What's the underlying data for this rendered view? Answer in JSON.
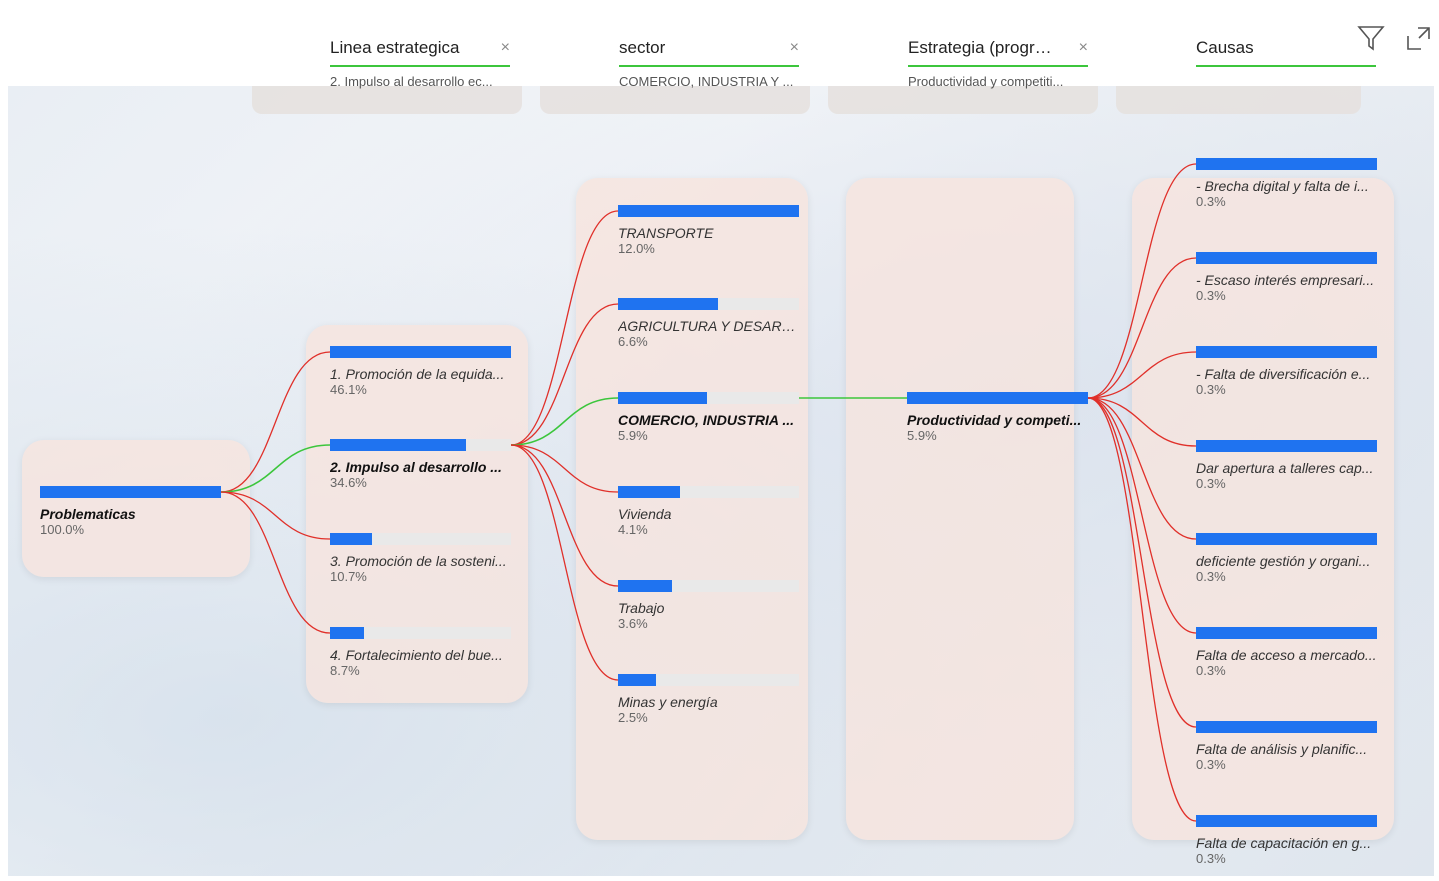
{
  "levels": [
    {
      "title": "Linea estrategica",
      "subtitle": "2. Impulso al desarrollo ec...",
      "close": "×"
    },
    {
      "title": "sector",
      "subtitle": "COMERCIO, INDUSTRIA Y ...",
      "close": "×"
    },
    {
      "title": "Estrategia (program...",
      "subtitle": "Productividad y competiti...",
      "close": "×"
    },
    {
      "title": "Causas",
      "subtitle": "",
      "close": ""
    }
  ],
  "colors": {
    "bar": "#1f73f0",
    "selected_link": "#3cc63c",
    "link": "#e0302a",
    "panel": "#f7e4de"
  },
  "root": {
    "label": "Problematicas",
    "pct": "100.0%",
    "value": 1.0
  },
  "col1": [
    {
      "label": "1. Promoción de la equida...",
      "pct": "46.1%",
      "value": 1.0
    },
    {
      "label": "2. Impulso al desarrollo ...",
      "pct": "34.6%",
      "value": 0.75,
      "selected": true
    },
    {
      "label": "3. Promoción de la sosteni...",
      "pct": "10.7%",
      "value": 0.23
    },
    {
      "label": "4. Fortalecimiento del bue...",
      "pct": "8.7%",
      "value": 0.19
    }
  ],
  "col2": [
    {
      "label": "TRANSPORTE",
      "pct": "12.0%",
      "value": 1.0
    },
    {
      "label": "AGRICULTURA Y DESARR...",
      "pct": "6.6%",
      "value": 0.55
    },
    {
      "label": "COMERCIO, INDUSTRIA ...",
      "pct": "5.9%",
      "value": 0.49,
      "selected": true
    },
    {
      "label": "Vivienda",
      "pct": "4.1%",
      "value": 0.34
    },
    {
      "label": "Trabajo",
      "pct": "3.6%",
      "value": 0.3
    },
    {
      "label": "Minas y energía",
      "pct": "2.5%",
      "value": 0.21
    }
  ],
  "col3": [
    {
      "label": "Productividad y competi...",
      "pct": "5.9%",
      "value": 1.0,
      "selected": true
    }
  ],
  "col4": [
    {
      "label": "- Brecha digital y falta de i...",
      "pct": "0.3%",
      "value": 1.0
    },
    {
      "label": "- Escaso interés empresari...",
      "pct": "0.3%",
      "value": 1.0
    },
    {
      "label": "- Falta de diversificación e...",
      "pct": "0.3%",
      "value": 1.0
    },
    {
      "label": "Dar apertura a talleres cap...",
      "pct": "0.3%",
      "value": 1.0
    },
    {
      "label": "deficiente gestión y organi...",
      "pct": "0.3%",
      "value": 1.0
    },
    {
      "label": "Falta de acceso a mercado...",
      "pct": "0.3%",
      "value": 1.0
    },
    {
      "label": "Falta de análisis y planific...",
      "pct": "0.3%",
      "value": 1.0
    },
    {
      "label": "Falta de capacitación en g...",
      "pct": "0.3%",
      "value": 1.0
    }
  ],
  "tools": {
    "filter_icon": "filter-icon",
    "expand_icon": "expand-icon"
  }
}
